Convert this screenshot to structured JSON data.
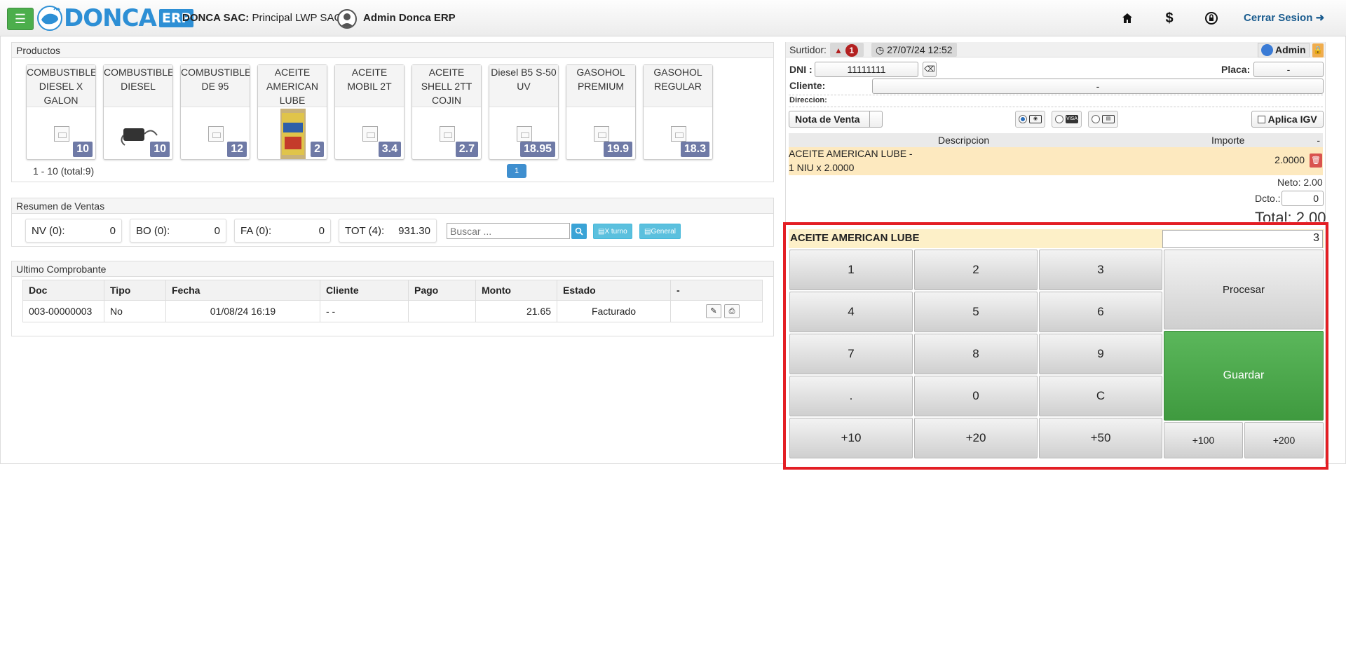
{
  "topbar": {
    "company_label": "DONCA SAC:",
    "company_branch": "Principal LWP SAC |",
    "user_name": "Admin Donca ERP",
    "logo_text": "DONCA",
    "logo_suffix": "ERP",
    "logout_label": "Cerrar Sesion",
    "icons": [
      "home-icon",
      "dollar-icon",
      "lock-reset-icon",
      "logout-icon"
    ]
  },
  "products": {
    "title": "Productos",
    "items": [
      {
        "name": "COMBUSTIBLE DIESEL X GALON",
        "price": "10",
        "image": "no-image"
      },
      {
        "name": "COMBUSTIBLE DIESEL",
        "price": "10",
        "image": "charger-photo"
      },
      {
        "name": "COMBUSTIBLE DE 95",
        "price": "12",
        "image": "no-image"
      },
      {
        "name": "ACEITE AMERICAN LUBE",
        "price": "2",
        "image": "oil-bottle-photo"
      },
      {
        "name": "ACEITE MOBIL 2T",
        "price": "3.4",
        "image": "no-image"
      },
      {
        "name": "ACEITE SHELL 2TT COJIN",
        "price": "2.7",
        "image": "no-image"
      },
      {
        "name": "Diesel B5 S-50 UV",
        "price": "18.95",
        "image": "no-image"
      },
      {
        "name": "GASOHOL PREMIUM",
        "price": "19.9",
        "image": "no-image"
      },
      {
        "name": "GASOHOL REGULAR",
        "price": "18.3",
        "image": "no-image"
      }
    ],
    "pagination_info": "1 - 10 (total:9)",
    "current_page": "1"
  },
  "summary": {
    "title": "Resumen de Ventas",
    "boxes": [
      {
        "label": "NV (0):",
        "value": "0"
      },
      {
        "label": "BO (0):",
        "value": "0"
      },
      {
        "label": "FA (0):",
        "value": "0"
      },
      {
        "label": "TOT (4):",
        "value": "931.30"
      }
    ],
    "search_placeholder": "Buscar ...",
    "btn_turno": "X turno",
    "btn_general": "General"
  },
  "last_receipt": {
    "title": "Ultimo Comprobante",
    "columns": [
      "Doc",
      "Tipo",
      "Fecha",
      "Cliente",
      "Pago",
      "Monto",
      "Estado",
      "-"
    ],
    "rows": [
      {
        "doc": "003-00000003",
        "tipo": "No",
        "fecha": "01/08/24 16:19",
        "cliente": "- -",
        "pago": "",
        "monto": "21.65",
        "estado": "Facturado"
      }
    ]
  },
  "sale": {
    "surtidor_label": "Surtidor:",
    "surtidor_count": "1",
    "datetime": "27/07/24 12:52",
    "admin_label": "Admin",
    "dni_label": "DNI :",
    "dni_value": "11111111",
    "placa_label": "Placa:",
    "placa_value": "-",
    "cliente_label": "Cliente:",
    "cliente_value": "-",
    "direccion_label": "Direccion:",
    "doc_type": "Nota de Venta",
    "aplica_igv": "Aplica IGV",
    "col_desc": "Descripcion",
    "col_importe": "Importe",
    "col_dash": "-",
    "item_line1": "ACEITE AMERICAN LUBE -",
    "item_line2": "1 NIU x 2.0000",
    "item_amount": "2.0000",
    "neto": "Neto: 2.00",
    "dcto_label": "Dcto.:",
    "dcto_value": "0",
    "total": "Total: 2.00"
  },
  "keypad": {
    "product": "ACEITE AMERICAN LUBE",
    "quantity": "3",
    "keys": {
      "k1": "1",
      "k2": "2",
      "k3": "3",
      "k4": "4",
      "k5": "5",
      "k6": "6",
      "k7": "7",
      "k8": "8",
      "k9": "9",
      "kdot": ".",
      "k0": "0",
      "kc": "C",
      "p10": "+10",
      "p20": "+20",
      "p50": "+50",
      "p100": "+100",
      "p200": "+200"
    },
    "procesar": "Procesar",
    "guardar": "Guardar"
  }
}
